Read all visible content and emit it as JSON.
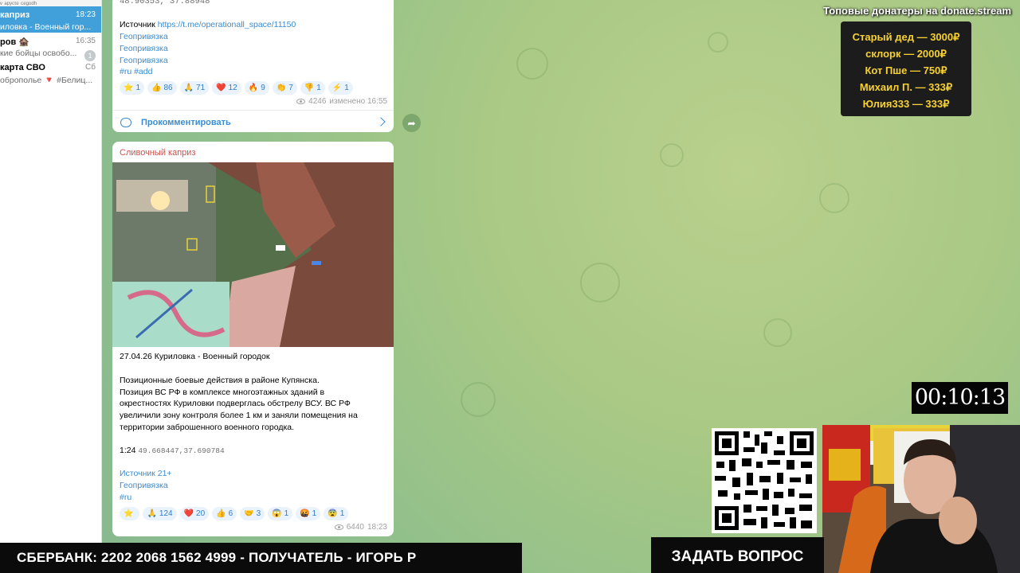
{
  "chat_list": [
    {
      "name": "",
      "time": "",
      "preview": "ᵛ ᵃᵖʸᶜᵗᵉ ᶜᵉᵍᵒᵈʰ",
      "active": false,
      "sliver": true
    },
    {
      "name": "каприз",
      "time": "18:23",
      "preview": "иловка - Военный гор...",
      "active": true
    },
    {
      "name": "ров 🏚️",
      "time": "16:35",
      "preview": "кие бойцы освобо...",
      "badge": "1",
      "active": false
    },
    {
      "name": "карта СВО",
      "time": "Сб",
      "preview": "оброполье 🔻 #Белиц...",
      "active": false
    }
  ],
  "message1": {
    "coords_partial": "48.90353, 37.88948",
    "source_label": "Источник",
    "source_url": "https://t.me/operationall_space/11150",
    "geo1": "Геопривязка",
    "geo2": "Геопривязка",
    "geo3": "Геопривязка",
    "tags": "#ru #add",
    "reactions": [
      {
        "emoji": "⭐",
        "count": "1"
      },
      {
        "emoji": "👍",
        "count": "86"
      },
      {
        "emoji": "🙏",
        "count": "71"
      },
      {
        "emoji": "❤️",
        "count": "12"
      },
      {
        "emoji": "🔥",
        "count": "9"
      },
      {
        "emoji": "👏",
        "count": "7"
      },
      {
        "emoji": "👎",
        "count": "1"
      },
      {
        "emoji": "⚡",
        "count": "1"
      }
    ],
    "views": "4246",
    "edited": "изменено 16:55",
    "comment_label": "Прокомментировать"
  },
  "message2": {
    "sender": "Сливочный каприз",
    "title": "27.04.26 Куриловка - Военный городок",
    "body": [
      "Позиционные боевые действия в районе Купянска.",
      "Позиция ВС РФ в комплексе многоэтажных зданий в",
      "окрестностях Куриловки подверглась обстрелу ВСУ. ВС РФ",
      "увеличили зону контроля более 1 км и заняли помещения на",
      "территории заброшенного военного городка."
    ],
    "time_code": "1:24",
    "coords": "49.668447,37.690784",
    "source": "Источник 21+",
    "geo": "Геопривязка",
    "tags": "#ru",
    "reactions": [
      {
        "emoji": "⭐",
        "count": ""
      },
      {
        "emoji": "🙏",
        "count": "124"
      },
      {
        "emoji": "❤️",
        "count": "20"
      },
      {
        "emoji": "👍",
        "count": "6"
      },
      {
        "emoji": "🤝",
        "count": "3"
      },
      {
        "emoji": "😱",
        "count": "1"
      },
      {
        "emoji": "🤬",
        "count": "1"
      },
      {
        "emoji": "😨",
        "count": "1"
      }
    ],
    "views": "6440",
    "time": "18:23"
  },
  "overlay": {
    "donators_title": "Топовые донатеры на donate.stream",
    "donators": [
      "Старый дед — 3000₽",
      "склорк — 2000₽",
      "Кот Пше — 750₽",
      "Михаил П. — 333₽",
      "Юлия333 — 333₽"
    ],
    "timer": "00:10:13",
    "bank_text": "СБЕРБАНК: 2202 2068 1562 4999 - ПОЛУЧАТЕЛЬ - ИГОРЬ Р",
    "ask_label": "ЗАДАТЬ ВОПРОС"
  },
  "colors": {
    "accent": "#419fd9",
    "link": "#3a8bd1",
    "sender": "#d0504a",
    "donor_text": "#f7d132"
  }
}
